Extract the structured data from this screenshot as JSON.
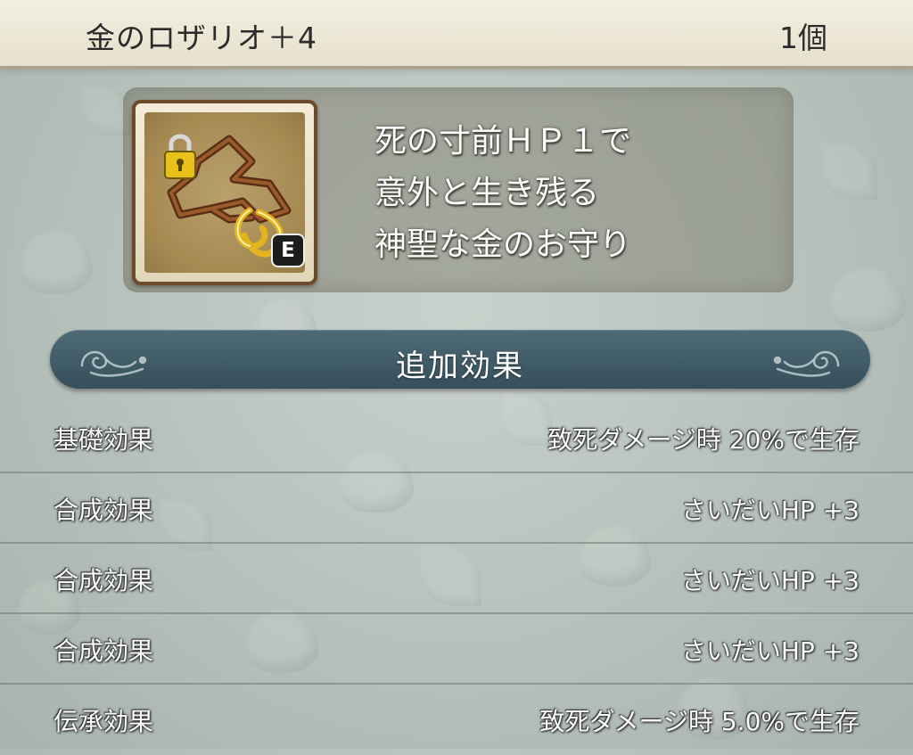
{
  "header": {
    "item_name": "金のロザリオ＋4",
    "count": "1個"
  },
  "item": {
    "icon": "gold-rosary-icon",
    "equip_badge": "E",
    "description": [
      "死の寸前ＨＰ１で",
      "意外と生き残る",
      "神聖な金のお守り"
    ]
  },
  "effects_section": {
    "title": "追加効果",
    "rows": [
      {
        "label": "基礎効果",
        "value": "致死ダメージ時  20%で生存"
      },
      {
        "label": "合成効果",
        "value": "さいだいHP  +3"
      },
      {
        "label": "合成効果",
        "value": "さいだいHP  +3"
      },
      {
        "label": "合成効果",
        "value": "さいだいHP  +3"
      },
      {
        "label": "伝承効果",
        "value": "致死ダメージ時  5.0%で生存"
      }
    ]
  },
  "colors": {
    "title_bar": "#ece7d6",
    "section_header": "#3f5b66",
    "icon_frame": "#6e4a2c"
  }
}
